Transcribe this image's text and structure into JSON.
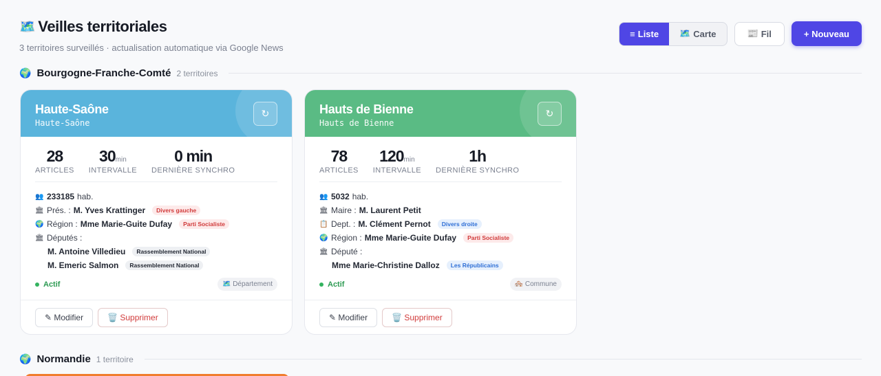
{
  "header": {
    "title_icon": "🗺️",
    "title": "Veilles territoriales",
    "subtitle": "3 territoires surveillés · actualisation automatique via Google News"
  },
  "toolbar": {
    "list_icon": "≡",
    "list_label": "Liste",
    "map_icon": "🗺️",
    "map_label": "Carte",
    "feed_icon": "📰",
    "feed_label": "Fil",
    "new_label": "+ Nouveau"
  },
  "groups": [
    {
      "icon": "🌍",
      "name": "Bourgogne-Franche-Comté",
      "count": "2 territoires",
      "cards": [
        {
          "color": "#5ab4dc",
          "name": "Haute-Saône",
          "slug": "Haute-Saône",
          "refresh_icon": "↻",
          "stats": {
            "articles": "28",
            "articles_label": "ARTICLES",
            "interval": "30",
            "interval_unit": "min",
            "interval_label": "INTERVALLE",
            "sync": "0 min",
            "sync_label": "DERNIÈRE SYNCHRO"
          },
          "population_icon": "👥",
          "population": "233185",
          "population_unit": "hab.",
          "lead": {
            "icon": "🏛",
            "role": "Prés. :",
            "name": "M. Yves Krattinger",
            "party": "Divers gauche"
          },
          "region": {
            "icon": "🌍",
            "role": "Région :",
            "name": "Mme Marie-Guite Dufay",
            "party": "Parti Socialiste"
          },
          "deputies_icon": "🏛",
          "deputies_label": "Députés :",
          "deputies": [
            {
              "name": "M. Antoine Villedieu",
              "party": "Rassemblement National"
            },
            {
              "name": "M. Emeric Salmon",
              "party": "Rassemblement National"
            }
          ],
          "status": "Actif",
          "type_icon": "🗺️",
          "type": "Département",
          "edit_label": "✎ Modifier",
          "delete_label": "🗑️ Supprimer"
        },
        {
          "color": "#5abb84",
          "name": "Hauts de Bienne",
          "slug": "Hauts de Bienne",
          "refresh_icon": "↻",
          "stats": {
            "articles": "78",
            "articles_label": "ARTICLES",
            "interval": "120",
            "interval_unit": "min",
            "interval_label": "INTERVALLE",
            "sync": "1h",
            "sync_label": "DERNIÈRE SYNCHRO"
          },
          "population_icon": "👥",
          "population": "5032",
          "population_unit": "hab.",
          "lead": {
            "icon": "🏛",
            "role": "Maire :",
            "name": "M. Laurent Petit"
          },
          "dept": {
            "icon": "📋",
            "role": "Dept. :",
            "name": "M. Clément Pernot",
            "party": "Divers droite"
          },
          "region": {
            "icon": "🌍",
            "role": "Région :",
            "name": "Mme Marie-Guite Dufay",
            "party": "Parti Socialiste"
          },
          "deputies_icon": "🏛",
          "deputies_label": "Député :",
          "deputies": [
            {
              "name": "Mme Marie-Christine Dalloz",
              "party": "Les Républicains"
            }
          ],
          "status": "Actif",
          "type_icon": "🏘️",
          "type": "Commune",
          "edit_label": "✎ Modifier",
          "delete_label": "🗑️ Supprimer"
        }
      ]
    },
    {
      "icon": "🌍",
      "name": "Normandie",
      "count": "1 territoire",
      "peek_color": "#f07d2e"
    }
  ]
}
